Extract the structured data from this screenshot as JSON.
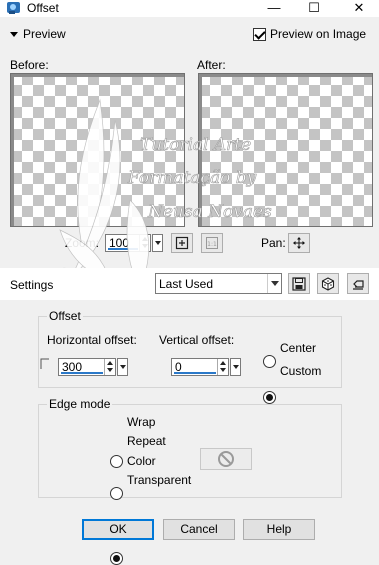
{
  "window": {
    "title": "Offset",
    "controls": {
      "minimize": "—",
      "maximize": "☐",
      "close": "✕"
    }
  },
  "preview": {
    "toggle_label": "Preview",
    "preview_on_image_label": "Preview on Image",
    "preview_on_image_checked": true,
    "before_label": "Before:",
    "after_label": "After:"
  },
  "zoom": {
    "label": "Zoom:",
    "value": "100",
    "pan_label": "Pan:"
  },
  "settings": {
    "label": "Settings",
    "preset": "Last Used"
  },
  "offset": {
    "group_title": "Offset",
    "horizontal_label": "Horizontal offset:",
    "horizontal_value": "300",
    "vertical_label": "Vertical offset:",
    "vertical_value": "0",
    "mode_options": [
      "Center",
      "Custom"
    ],
    "mode_selected": "Custom"
  },
  "edge_mode": {
    "group_title": "Edge mode",
    "options": [
      "Wrap",
      "Repeat",
      "Color",
      "Transparent"
    ],
    "selected": "Transparent"
  },
  "buttons": {
    "ok": "OK",
    "cancel": "Cancel",
    "help": "Help"
  },
  "watermark": {
    "lines": [
      "Tutorial Arte",
      "Formatação by",
      "Neusa Novaes"
    ]
  },
  "colors": {
    "accent": "#0078d7",
    "checker": "#c4c4c4",
    "dialog_bg": "#f0f0f0"
  }
}
